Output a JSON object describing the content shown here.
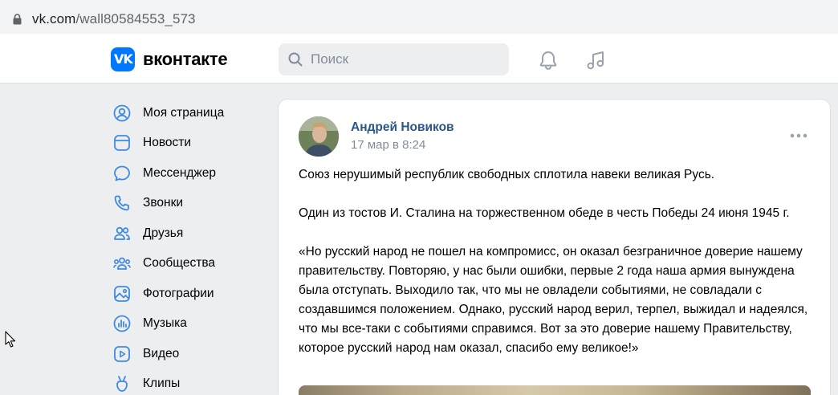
{
  "browser": {
    "url_host": "vk.com",
    "url_path": "/wall80584553_573"
  },
  "header": {
    "logo_mark": "VK",
    "logo_text": "вконтакте",
    "search_placeholder": "Поиск",
    "accent": "#0077ff"
  },
  "sidebar": {
    "items": [
      {
        "label": "Моя страница",
        "icon": "user-circle-icon"
      },
      {
        "label": "Новости",
        "icon": "news-icon"
      },
      {
        "label": "Мессенджер",
        "icon": "message-icon"
      },
      {
        "label": "Звонки",
        "icon": "phone-icon"
      },
      {
        "label": "Друзья",
        "icon": "friends-icon"
      },
      {
        "label": "Сообщества",
        "icon": "communities-icon"
      },
      {
        "label": "Фотографии",
        "icon": "photo-icon"
      },
      {
        "label": "Музыка",
        "icon": "music-icon"
      },
      {
        "label": "Видео",
        "icon": "video-icon"
      },
      {
        "label": "Клипы",
        "icon": "clips-icon"
      }
    ]
  },
  "post": {
    "author": "Андрей Новиков",
    "date": "17 мар в 8:24",
    "paragraphs": [
      "Союз нерушимый республик свободных сплотила навеки великая Русь.",
      "Один из тостов И. Сталина на торжественном обеде в честь Победы 24 июня 1945 г.",
      "«Но русский народ не пошел на компромисс, он оказал безграничное доверие нашему правительству. Повторяю, у нас были ошибки, первые 2 года наша армия вынуждена была отступать. Выходило так, что мы не овладели событиями, не совладали с создавшимся положением. Однако, русский народ верил, терпел, выжидал и надеялся, что мы все-таки с событиями справимся. Вот за это доверие нашему Правительству, которое русский народ нам оказал, спасибо ему великое!»"
    ]
  }
}
